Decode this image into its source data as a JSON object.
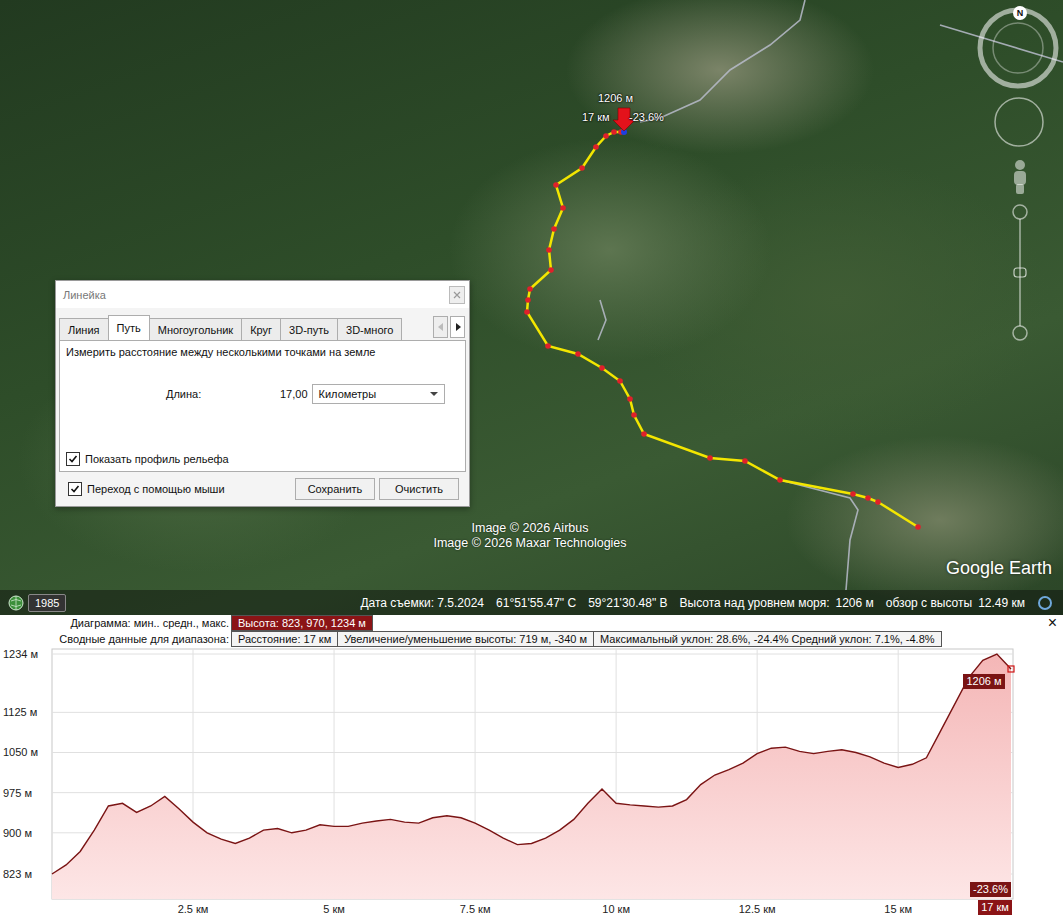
{
  "map": {
    "compass": "N",
    "imagery_credits": [
      "Image © 2026 Airbus",
      "Image © 2026 Maxar Technologies"
    ],
    "logo": "Google Earth",
    "path_labels": {
      "elevation": "1206 м",
      "distance": "17 км",
      "slope": "-23.6%"
    }
  },
  "status_bar": {
    "year": "1985",
    "date": "Дата съемки: 7.5.2024",
    "latitude": "61°51'55.47\" С",
    "longitude": "59°21'30.48\" В",
    "elevation_label": "Высота над уровнем моря:",
    "elevation": "1206 м",
    "eye_label": "обзор с высоты",
    "eye": "12.49 км"
  },
  "ruler": {
    "title": "Линейка",
    "tabs": [
      {
        "label": "Линия",
        "selected": false
      },
      {
        "label": "Путь",
        "selected": true
      },
      {
        "label": "Многоугольник",
        "selected": false
      },
      {
        "label": "Круг",
        "selected": false
      },
      {
        "label": "3D-путь",
        "selected": false
      },
      {
        "label": "3D-много",
        "selected": false
      }
    ],
    "description": "Измерить расстояние между несколькими точками на земле",
    "length_label": "Длина:",
    "length_value": "17,00",
    "unit": "Километры",
    "show_profile": {
      "label": "Показать профиль рельефа",
      "checked": true
    },
    "mouse_navigation": {
      "label": "Переход с помощью мыши",
      "checked": true
    },
    "buttons": [
      "Сохранить",
      "Очистить"
    ]
  },
  "profile": {
    "summary_label": "Диаграмма: мин.. средн., макс.",
    "height": "Высота: 823, 970, 1234 м",
    "range_label": "Сводные данные для диапазона:",
    "stats": [
      "Расстояние: 17 км",
      "Увеличение/уменьшение высоты: 719 м, -340 м",
      "Максимальный уклон: 28.6%, -24.4% Средний уклон: 7.1%, -4.8%"
    ],
    "close": "×",
    "y_min": 823,
    "y_max": 1234,
    "x_max": 17,
    "y_ticks": [
      {
        "label": "1234 м",
        "value": 1234
      },
      {
        "label": "1125 м",
        "value": 1125
      },
      {
        "label": "1050 м",
        "value": 1050
      },
      {
        "label": "975 м",
        "value": 975
      },
      {
        "label": "900 м",
        "value": 900
      },
      {
        "label": "823 м",
        "value": 823
      }
    ],
    "x_ticks": [
      {
        "label": "2.5 км",
        "value": 2.5
      },
      {
        "label": "5 км",
        "value": 5
      },
      {
        "label": "7.5 км",
        "value": 7.5
      },
      {
        "label": "10 км",
        "value": 10
      },
      {
        "label": "12.5 км",
        "value": 12.5
      },
      {
        "label": "15 км",
        "value": 15
      }
    ],
    "cursor": {
      "distance": "17 км",
      "elevation": "1206 м",
      "slope": "-23.6%"
    },
    "series": [
      {
        "name": "elevation",
        "values": [
          823,
          840,
          865,
          905,
          950,
          955,
          938,
          950,
          968,
          945,
          920,
          900,
          888,
          880,
          890,
          905,
          908,
          900,
          905,
          915,
          912,
          912,
          918,
          922,
          925,
          920,
          918,
          928,
          932,
          928,
          918,
          905,
          890,
          878,
          880,
          890,
          905,
          925,
          955,
          982,
          955,
          952,
          950,
          948,
          950,
          962,
          990,
          1008,
          1018,
          1030,
          1048,
          1058,
          1060,
          1052,
          1048,
          1052,
          1055,
          1050,
          1042,
          1030,
          1022,
          1028,
          1040,
          1090,
          1140,
          1190,
          1222,
          1234,
          1206
        ]
      }
    ]
  }
}
